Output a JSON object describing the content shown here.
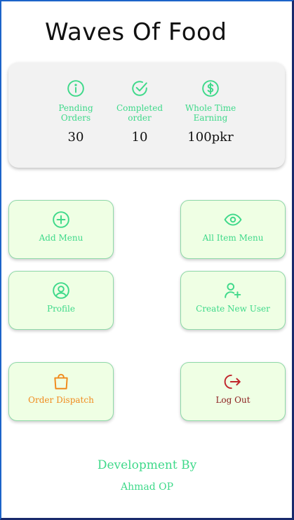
{
  "app": {
    "title": "Waves Of Food"
  },
  "colors": {
    "accent": "#3fd98a",
    "orange": "#f08a1c",
    "red": "#c0262c",
    "tile_bg": "#efffe4"
  },
  "stats": [
    {
      "icon": "info-icon",
      "label_line1": "Pending",
      "label_line2": "Orders",
      "value": "30"
    },
    {
      "icon": "check-circle-icon",
      "label_line1": "Completed",
      "label_line2": "order",
      "value": "10"
    },
    {
      "icon": "dollar-circle-icon",
      "label_line1": "Whole Time",
      "label_line2": "Earning",
      "value": "100pkr"
    }
  ],
  "menu": {
    "add_menu": {
      "label": "Add Menu",
      "icon": "plus-circle-icon"
    },
    "all_item_menu": {
      "label": "All Item Menu",
      "icon": "eye-icon"
    },
    "profile": {
      "label": "Profile",
      "icon": "user-circle-icon"
    },
    "create_new_user": {
      "label": "Create New User",
      "icon": "user-plus-icon"
    },
    "order_dispatch": {
      "label": "Order Dispatch",
      "icon": "shopping-bag-icon"
    },
    "log_out": {
      "label": "Log Out",
      "icon": "logout-icon"
    }
  },
  "footer": {
    "title": "Development By",
    "name": "Ahmad OP"
  }
}
